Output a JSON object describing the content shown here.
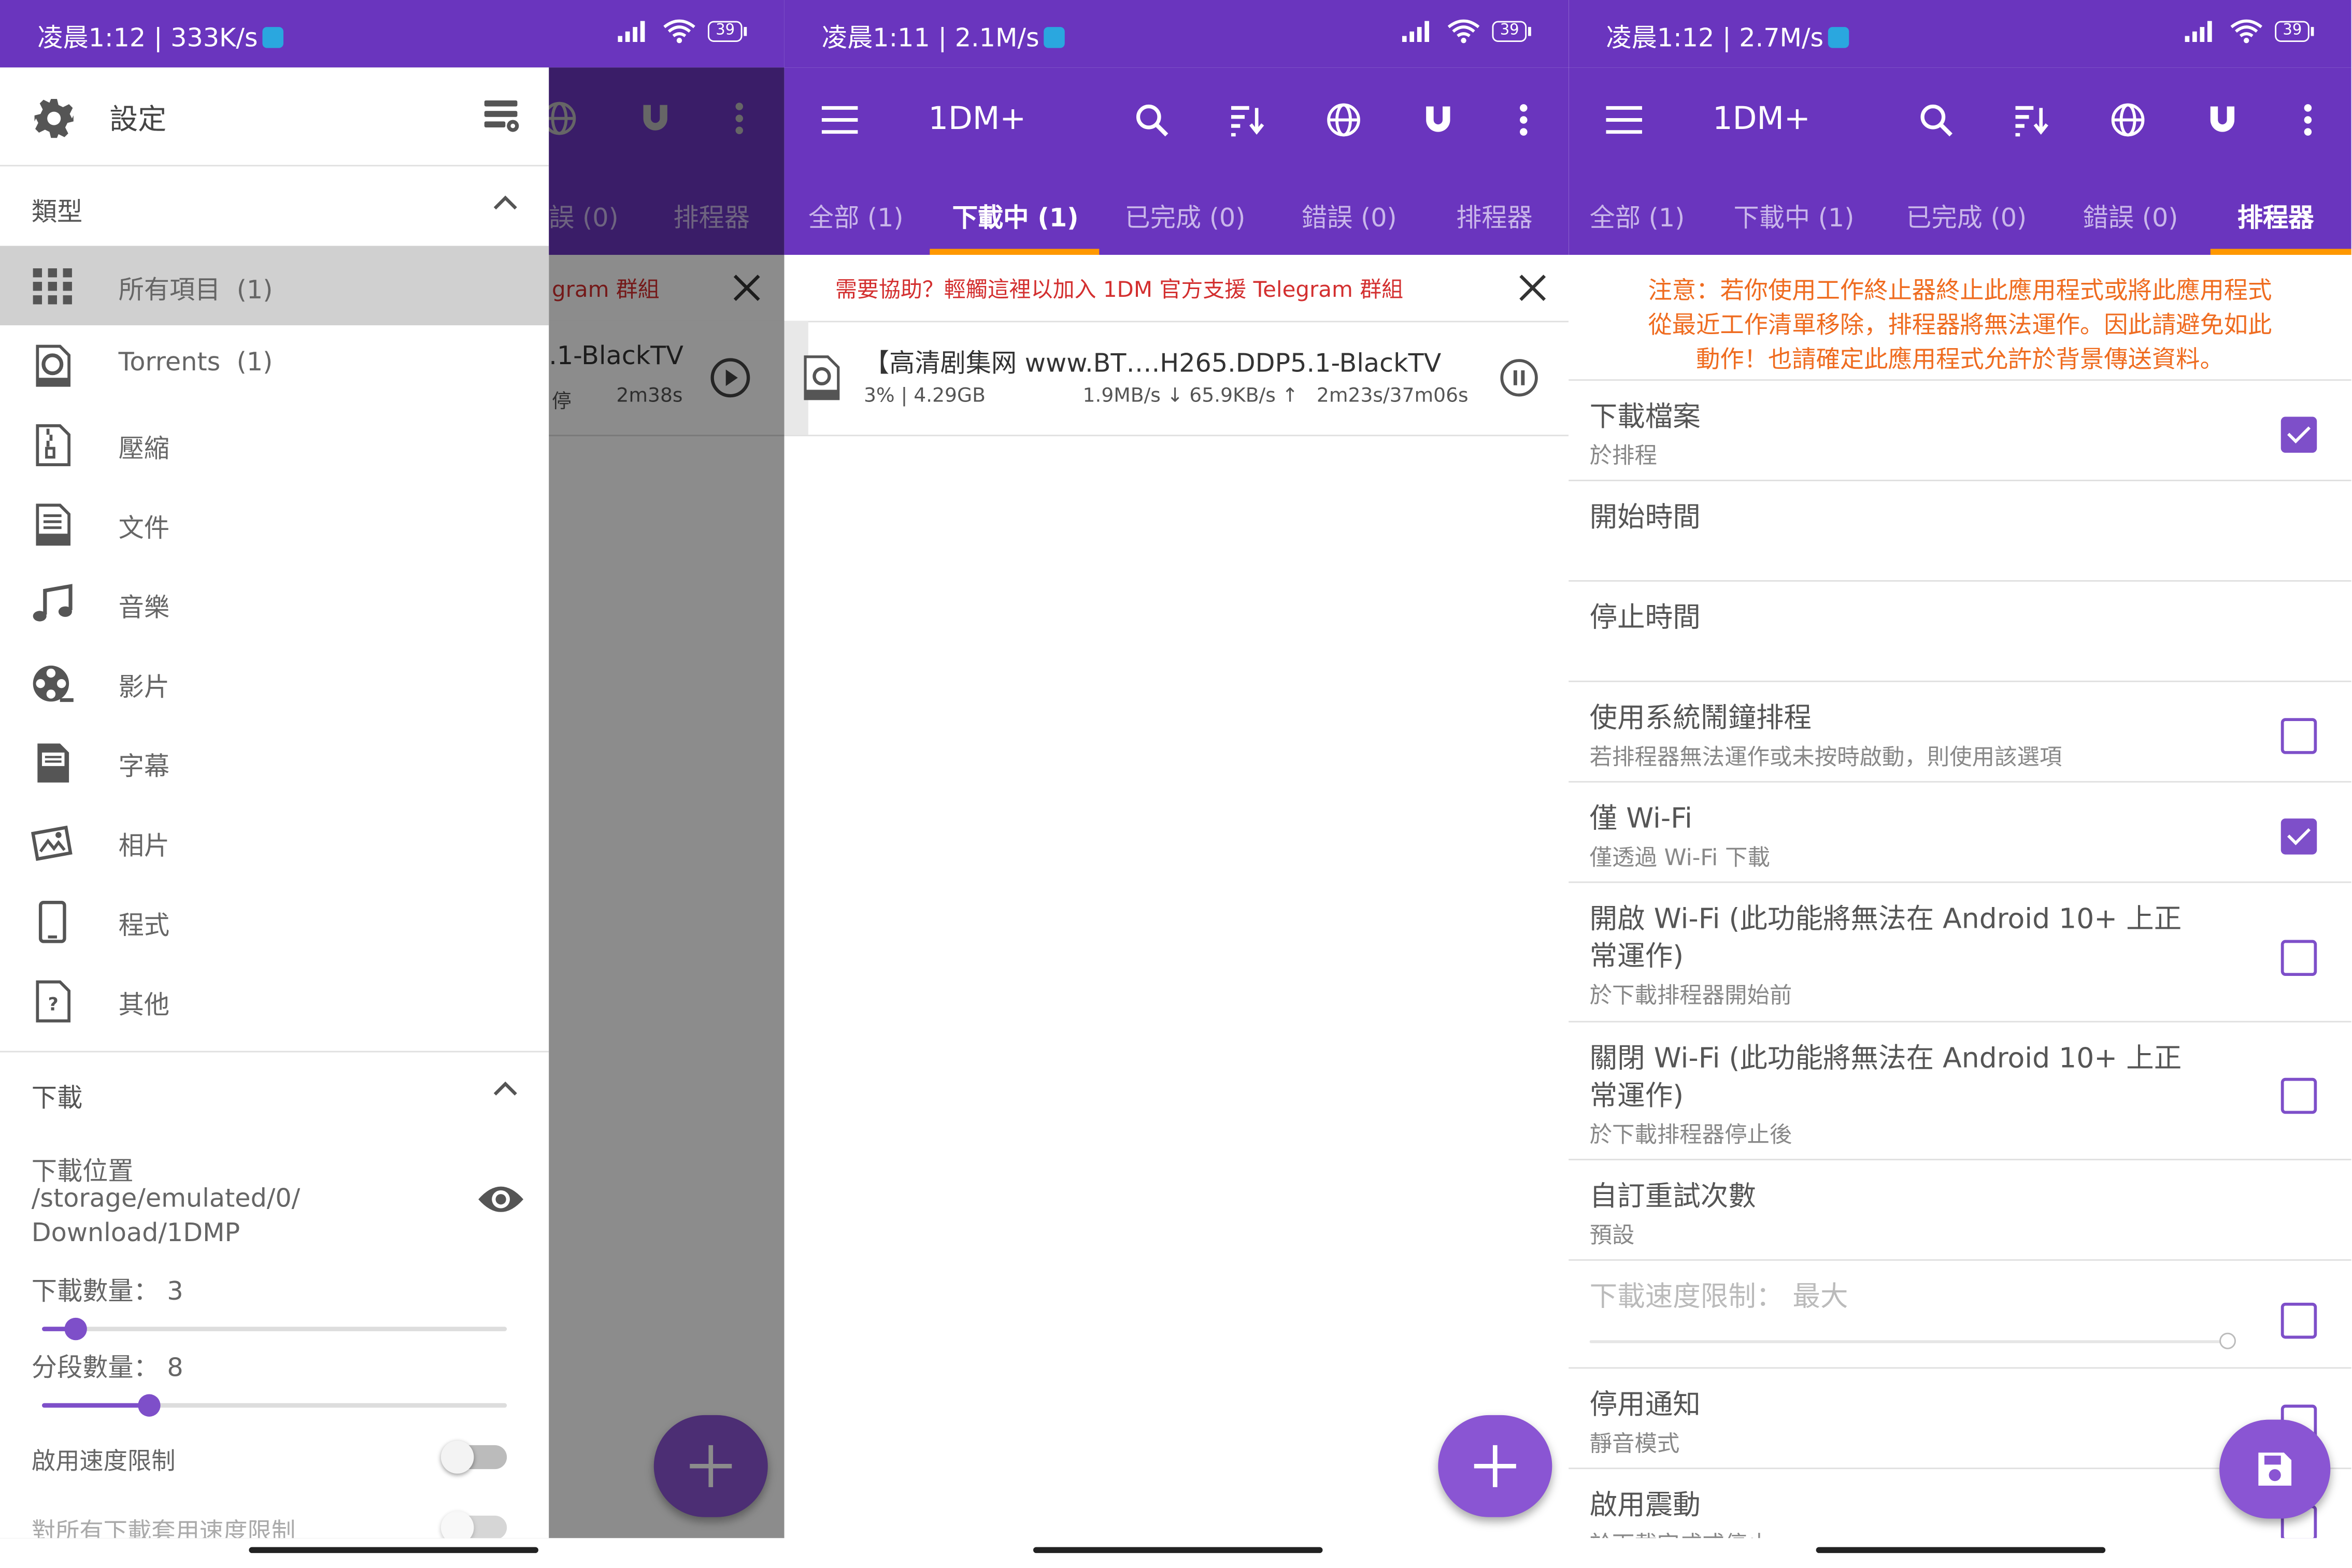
{
  "colors": {
    "primary": "#6a35be",
    "accent": "#ff9800",
    "fab": "#8a55d3",
    "checkbox": "#7e4fc9",
    "warning_text": "#ef6c20",
    "banner_text": "#d32f2f"
  },
  "screen1": {
    "status": {
      "time": "凌晨1:12",
      "speed": "333K/s",
      "battery": "39"
    },
    "header": {
      "title": "設定",
      "icons": [
        "gear-icon",
        "settings-list-icon"
      ]
    },
    "categories": {
      "label": "類型",
      "items": [
        {
          "label": "所有項目",
          "count": "(1)",
          "icon": "grid-icon"
        },
        {
          "label": "Torrents",
          "count": "(1)",
          "icon": "torrent-icon"
        },
        {
          "label": "壓縮",
          "count": "",
          "icon": "zip-icon"
        },
        {
          "label": "文件",
          "count": "",
          "icon": "doc-icon"
        },
        {
          "label": "音樂",
          "count": "",
          "icon": "music-icon"
        },
        {
          "label": "影片",
          "count": "",
          "icon": "film-reel-icon"
        },
        {
          "label": "字幕",
          "count": "",
          "icon": "subtitle-icon"
        },
        {
          "label": "相片",
          "count": "",
          "icon": "photo-icon"
        },
        {
          "label": "程式",
          "count": "",
          "icon": "phone-icon"
        },
        {
          "label": "其他",
          "count": "",
          "icon": "unknown-file-icon"
        }
      ]
    },
    "download": {
      "label": "下載",
      "location_label": "下載位置",
      "location_line1": "/storage/emulated/0/",
      "location_line2": "Download/1DMP",
      "count_label": "下載數量：",
      "count_value": "3",
      "count_fraction": 0.07,
      "parts_label": "分段數量：",
      "parts_value": "8",
      "parts_fraction": 0.23,
      "speed_limit_label": "啟用速度限制",
      "speed_limit_all_label": "對所有下載套用速度限制"
    },
    "behind": {
      "tab_errors": "誤 (0)",
      "tab_scheduler": "排程器",
      "banner_fragment": "gram 群組",
      "item_fragment": ".1-BlackTV",
      "item_status": "停",
      "item_time": "2m38s"
    }
  },
  "screen2": {
    "status": {
      "time": "凌晨1:11",
      "speed": "2.1M/s",
      "battery": "39"
    },
    "app_title": "1DM+",
    "tabs": [
      {
        "label": "全部 (1)",
        "active": false
      },
      {
        "label": "下載中 (1)",
        "active": true
      },
      {
        "label": "已完成 (0)",
        "active": false
      },
      {
        "label": "錯誤 (0)",
        "active": false
      },
      {
        "label": "排程器",
        "active": false
      }
    ],
    "banner": "需要協助？輕觸這裡以加入 1DM 官方支援 Telegram 群組",
    "download": {
      "title": "【高清剧集网 www.BT….H265.DDP5.1-BlackTV",
      "meta": "3% | 4.29GB",
      "speed": "1.9MB/s ↓  65.9KB/s ↑",
      "time": "2m23s/37m06s"
    }
  },
  "screen3": {
    "status": {
      "time": "凌晨1:12",
      "speed": "2.7M/s",
      "battery": "39"
    },
    "app_title": "1DM+",
    "tabs": [
      {
        "label": "全部 (1)",
        "active": false
      },
      {
        "label": "下載中 (1)",
        "active": false
      },
      {
        "label": "已完成 (0)",
        "active": false
      },
      {
        "label": "錯誤 (0)",
        "active": false
      },
      {
        "label": "排程器",
        "active": true
      }
    ],
    "note_line1": "注意：若你使用工作終止器終止此應用程式或將此應用程式",
    "note_line2": "從最近工作清單移除，排程器將無法運作。因此請避免如此",
    "note_line3": "動作！也請確定此應用程式允許於背景傳送資料。",
    "settings": [
      {
        "title": "下載檔案",
        "subtitle": "於排程",
        "checked": true
      },
      {
        "title": "開始時間",
        "subtitle": ""
      },
      {
        "title": "停止時間",
        "subtitle": ""
      },
      {
        "title": "使用系統鬧鐘排程",
        "subtitle": "若排程器無法運作或未按時啟動，則使用該選項",
        "checked": false
      },
      {
        "title": "僅 Wi-Fi",
        "subtitle": "僅透過 Wi-Fi 下載",
        "checked": true
      },
      {
        "title_line1": "開啟 Wi-Fi (此功能將無法在 Android 10+ 上正",
        "title_line2": "常運作)",
        "subtitle": "於下載排程器開始前",
        "checked": false
      },
      {
        "title_line1": "關閉 Wi-Fi (此功能將無法在 Android 10+ 上正",
        "title_line2": "常運作)",
        "subtitle": "於下載排程器停止後",
        "checked": false
      },
      {
        "title": "自訂重試次數",
        "subtitle": "預設"
      },
      {
        "title": "下載速度限制：  最大",
        "subtitle": "",
        "checked": false,
        "disabled": true
      },
      {
        "title": "停用通知",
        "subtitle": "靜音模式",
        "checked": false
      },
      {
        "title": "啟用震動",
        "subtitle": "於下載完成或停止",
        "checked": false
      }
    ]
  }
}
